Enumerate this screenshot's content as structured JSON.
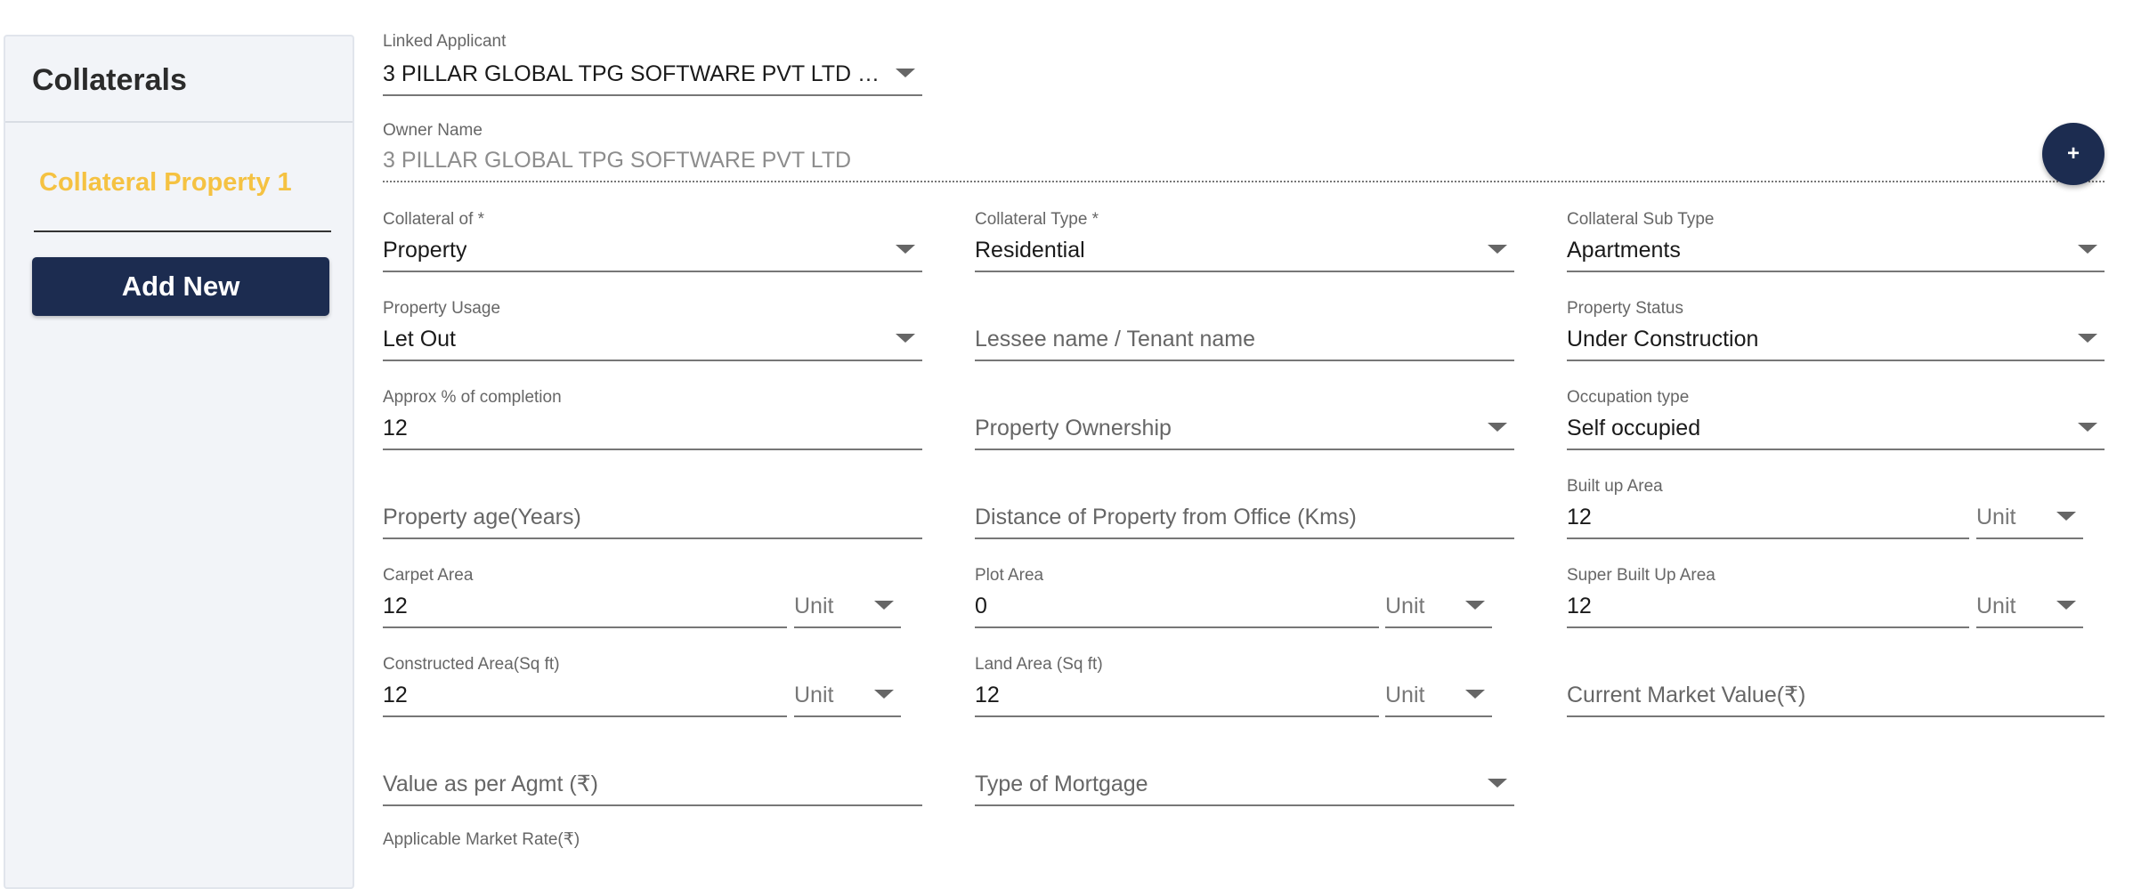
{
  "sidebar": {
    "title": "Collaterals",
    "items": [
      {
        "label": "Collateral Property 1"
      }
    ],
    "add_new_label": "Add New"
  },
  "fab": {
    "label": "+"
  },
  "form": {
    "linked_applicant": {
      "label": "Linked Applicant",
      "value": "3 PILLAR GLOBAL TPG SOFTWARE PVT LTD ( Pr…"
    },
    "owner_name": {
      "label": "Owner Name",
      "value": "3 PILLAR GLOBAL TPG SOFTWARE PVT LTD"
    },
    "collateral_of": {
      "label": "Collateral of *",
      "value": "Property"
    },
    "collateral_type": {
      "label": "Collateral Type *",
      "value": "Residential"
    },
    "collateral_sub_type": {
      "label": "Collateral Sub Type",
      "value": "Apartments"
    },
    "property_usage": {
      "label": "Property Usage",
      "value": "Let Out"
    },
    "lessee_name": {
      "placeholder": "Lessee name / Tenant name"
    },
    "property_status": {
      "label": "Property Status",
      "value": "Under Construction"
    },
    "approx_completion": {
      "label": "Approx % of completion",
      "value": "12"
    },
    "property_ownership": {
      "placeholder": "Property Ownership"
    },
    "occupation_type": {
      "label": "Occupation type",
      "value": "Self occupied"
    },
    "property_age": {
      "placeholder": "Property age(Years)"
    },
    "distance_from_office": {
      "placeholder": "Distance of Property from Office (Kms)"
    },
    "built_up_area": {
      "label": "Built up Area",
      "value": "12",
      "unit": "Unit"
    },
    "carpet_area": {
      "label": "Carpet Area",
      "value": "12",
      "unit": "Unit"
    },
    "plot_area": {
      "label": "Plot Area",
      "value": "0",
      "unit": "Unit"
    },
    "super_built_up_area": {
      "label": "Super Built Up Area",
      "value": "12",
      "unit": "Unit"
    },
    "constructed_area": {
      "label": "Constructed Area(Sq ft)",
      "value": "12",
      "unit": "Unit"
    },
    "land_area": {
      "label": "Land Area (Sq ft)",
      "value": "12",
      "unit": "Unit"
    },
    "current_market_value": {
      "placeholder": "Current Market Value(₹)"
    },
    "value_as_per_agmt": {
      "placeholder": "Value as per Agmt (₹)"
    },
    "type_of_mortgage": {
      "placeholder": "Type of Mortgage"
    },
    "applicable_market_rate": {
      "label": "Applicable Market Rate(₹)"
    }
  }
}
